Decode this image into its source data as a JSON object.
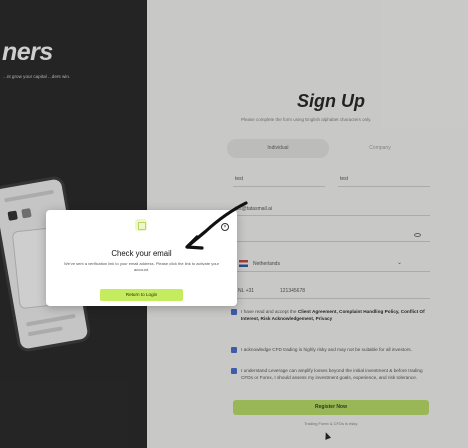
{
  "hero": {
    "title": "ners",
    "subtitle": "...nt grow your capital ...ders win."
  },
  "signup": {
    "title": "Sign Up",
    "subtitle": "Please complete the form using English alphabet characters only.",
    "tabs": [
      {
        "label": "Individual"
      },
      {
        "label": "Company"
      }
    ],
    "first_name": "test",
    "last_name": "test",
    "email": "tes@tatasmail.ai",
    "country": "Netherlands",
    "dial_code": "NL +31",
    "phone": "121345678",
    "agreement": {
      "prefix": "I have read and accept the ",
      "bold": "Client Agreement, Complaint Handling Policy, Conflict Of Interest, Risk Acknowledgement, Privacy"
    },
    "risk_ack": "I acknowledge CFD trading is highly risky and may not be suitable for all investors.",
    "leverage_ack": "I understand Leverage can amplify losses beyond the initial investment & before trading CFDs or Forex, I should assess my investment goals, experience, and risk tolerance.",
    "register_label": "Register Now",
    "footer": "Trading Forex & CFDs is risky."
  },
  "modal": {
    "title": "Check your email",
    "body": "We've sent a verification link to your email address. Please click the link to activate your account.",
    "button_label": "Return to Login"
  },
  "colors": {
    "accent": "#c5ec5f",
    "dark_panel": "#141414",
    "checkbox": "#3a62c8"
  }
}
